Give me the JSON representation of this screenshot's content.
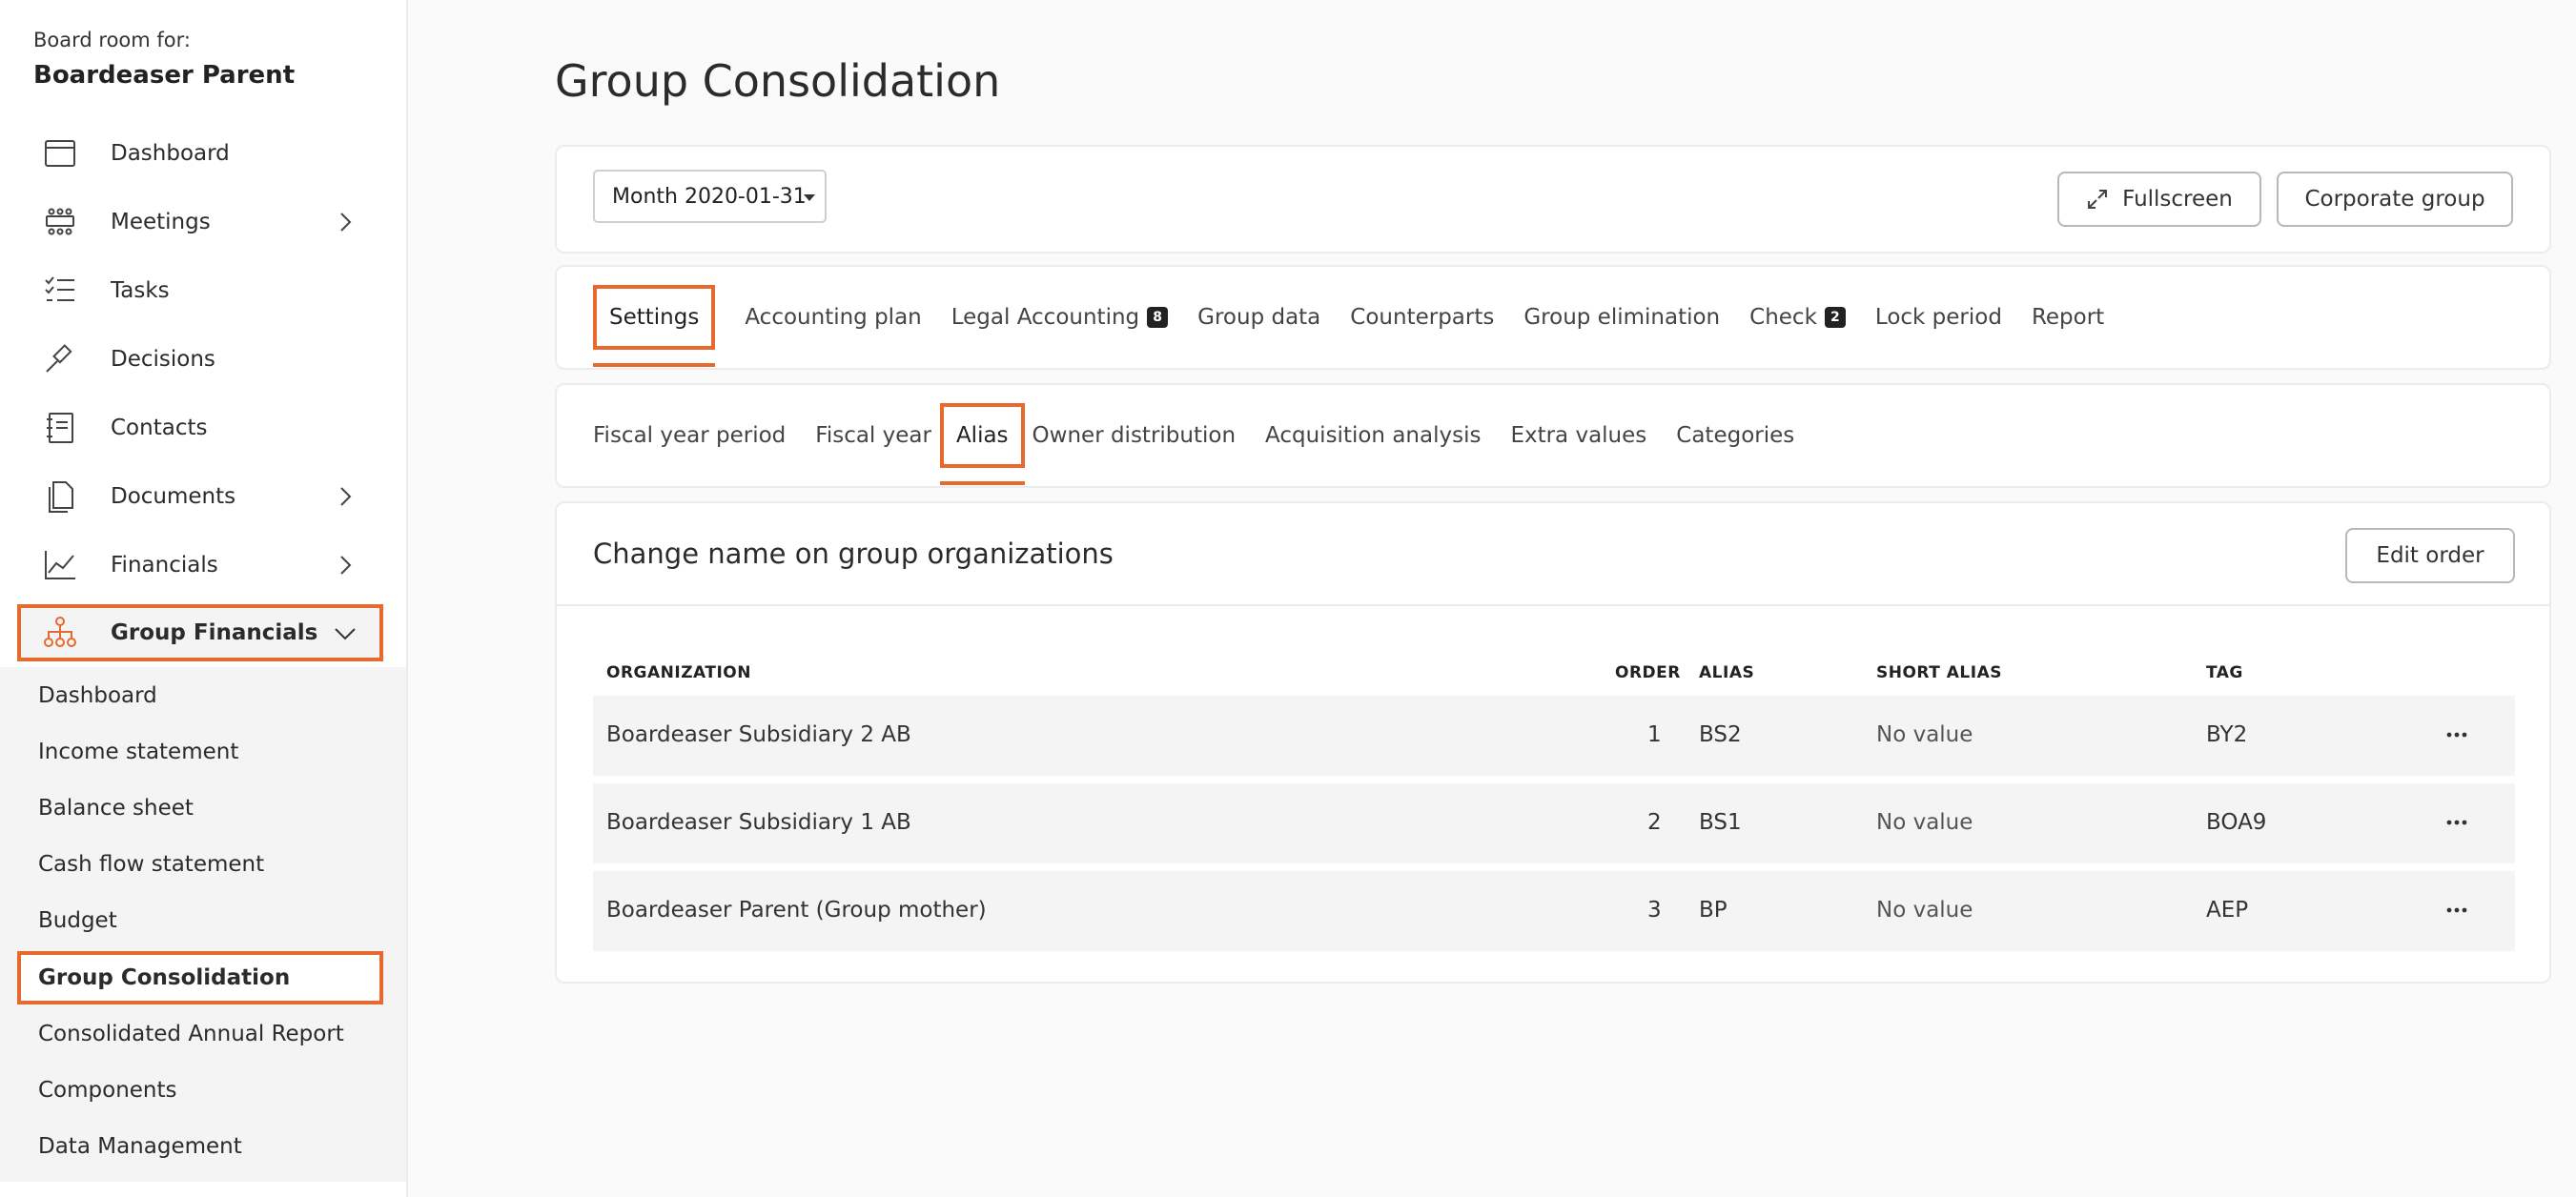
{
  "sidebar": {
    "board_label": "Board room for:",
    "board_name": "Boardeaser Parent",
    "items": [
      {
        "label": "Dashboard",
        "icon": "calendar-icon"
      },
      {
        "label": "Meetings",
        "icon": "meeting-icon"
      },
      {
        "label": "Tasks",
        "icon": "tasks-icon"
      },
      {
        "label": "Decisions",
        "icon": "gavel-icon"
      },
      {
        "label": "Contacts",
        "icon": "contacts-icon"
      },
      {
        "label": "Documents",
        "icon": "documents-icon"
      },
      {
        "label": "Financials",
        "icon": "chart-icon"
      },
      {
        "label": "Group Financials",
        "icon": "org-chart-icon"
      }
    ],
    "sub_items": [
      {
        "label": "Dashboard"
      },
      {
        "label": "Income statement"
      },
      {
        "label": "Balance sheet"
      },
      {
        "label": "Cash flow statement"
      },
      {
        "label": "Budget"
      },
      {
        "label": "Group Consolidation"
      },
      {
        "label": "Consolidated Annual Report"
      },
      {
        "label": "Components"
      },
      {
        "label": "Data Management"
      }
    ]
  },
  "page": {
    "title": "Group Consolidation"
  },
  "toolbar": {
    "month_value": "Month 2020-01-31",
    "fullscreen_label": "Fullscreen",
    "corporate_group_label": "Corporate group"
  },
  "tabs": [
    {
      "label": "Settings"
    },
    {
      "label": "Accounting plan"
    },
    {
      "label": "Legal Accounting",
      "badge": "8"
    },
    {
      "label": "Group data"
    },
    {
      "label": "Counterparts"
    },
    {
      "label": "Group elimination"
    },
    {
      "label": "Check",
      "badge": "2"
    },
    {
      "label": "Lock period"
    },
    {
      "label": "Report"
    }
  ],
  "subtabs": [
    {
      "label": "Fiscal year period"
    },
    {
      "label": "Fiscal year"
    },
    {
      "label": "Alias"
    },
    {
      "label": "Owner distribution"
    },
    {
      "label": "Acquisition analysis"
    },
    {
      "label": "Extra values"
    },
    {
      "label": "Categories"
    }
  ],
  "alias_card": {
    "title": "Change name on group organizations",
    "edit_order_label": "Edit order",
    "columns": {
      "organization": "ORGANIZATION",
      "order": "ORDER",
      "alias": "ALIAS",
      "short_alias": "SHORT ALIAS",
      "tag": "TAG"
    },
    "rows": [
      {
        "organization": "Boardeaser Subsidiary 2 AB",
        "order": "1",
        "alias": "BS2",
        "short_alias": "No value",
        "tag": "BY2"
      },
      {
        "organization": "Boardeaser Subsidiary 1 AB",
        "order": "2",
        "alias": "BS1",
        "short_alias": "No value",
        "tag": "BOA9"
      },
      {
        "organization": "Boardeaser Parent (Group mother)",
        "order": "3",
        "alias": "BP",
        "short_alias": "No value",
        "tag": "AEP"
      }
    ]
  },
  "colors": {
    "accent": "#e8692d",
    "sub_panel_bg": "#f4f4f4",
    "row_bg": "#f4f4f4",
    "badge_bg": "#222222"
  }
}
